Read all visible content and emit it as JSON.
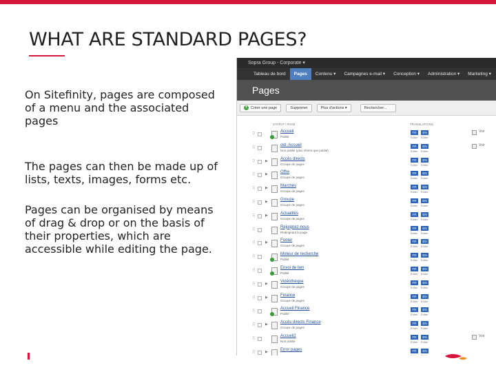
{
  "slide": {
    "title": "WHAT ARE STANDARD PAGES?",
    "paragraph1": "On Sitefinity, pages are composed of a menu and the associated pages",
    "paragraph2": "The pages can then be made up of lists, texts, images, forms etc.",
    "paragraph3": "Pages can be organised by means of drag & drop or on the basis of their properties, which are accessible while editing the page.",
    "accent_color": "#d6153b"
  },
  "screenshot": {
    "site_selector": "Sopra Group - Corporate",
    "nav": [
      {
        "label": "Tableau de bord",
        "active": false
      },
      {
        "label": "Pages",
        "active": true
      },
      {
        "label": "Contenu ▾",
        "active": false
      },
      {
        "label": "Campagnes e-mail ▾",
        "active": false
      },
      {
        "label": "Conception ▾",
        "active": false
      },
      {
        "label": "Administration ▾",
        "active": false
      },
      {
        "label": "Marketing ▾",
        "active": false
      }
    ],
    "header": "Pages",
    "toolbar": {
      "create": "Créer une page",
      "delete": "Supprimer",
      "more_actions": "Plus d'actions ▾",
      "search": "Rechercher..."
    },
    "columns": {
      "status_page": "STATUT / PAGE",
      "translations": "TRANSLATIONS"
    },
    "lang_fr": "FR",
    "lang_en": "EN",
    "edit_label": "Éditer",
    "view_label": "Voir",
    "rows": [
      {
        "name": "Accueil",
        "status": "Publié",
        "icon": "published",
        "caret": false,
        "view": true
      },
      {
        "name": "old_Accueil",
        "status": "Non publié (plus récent que publié)",
        "icon": "page",
        "caret": false,
        "view": true
      },
      {
        "name": "Accès directs",
        "status": "Groupe de pages",
        "icon": "group",
        "caret": true,
        "view": false
      },
      {
        "name": "Offre",
        "status": "Groupe de pages",
        "icon": "group",
        "caret": true,
        "view": false
      },
      {
        "name": "Marchés",
        "status": "Groupe de pages",
        "icon": "group",
        "caret": true,
        "view": false
      },
      {
        "name": "Groupe",
        "status": "Groupe de pages",
        "icon": "group",
        "caret": true,
        "view": false
      },
      {
        "name": "Actualités",
        "status": "Groupe de pages",
        "icon": "group",
        "caret": true,
        "view": false
      },
      {
        "name": "Rejoignez-nous",
        "status": "Redirigeant la page",
        "icon": "page",
        "caret": false,
        "view": false
      },
      {
        "name": "Footer",
        "status": "Groupe de pages",
        "icon": "group",
        "caret": true,
        "view": false
      },
      {
        "name": "Moteur de recherche",
        "status": "Publié",
        "icon": "published",
        "caret": false,
        "view": false
      },
      {
        "name": "Envoi de lien",
        "status": "Publié",
        "icon": "published",
        "caret": false,
        "view": false
      },
      {
        "name": "Vidéothèque",
        "status": "Groupe de pages",
        "icon": "group",
        "caret": true,
        "view": false
      },
      {
        "name": "Finance",
        "status": "Groupe de pages",
        "icon": "group",
        "caret": true,
        "view": false
      },
      {
        "name": "Accueil Finance",
        "status": "Publié",
        "icon": "published",
        "caret": false,
        "view": false
      },
      {
        "name": "Accès directs Finance",
        "status": "Groupe de pages",
        "icon": "group",
        "caret": true,
        "view": false
      },
      {
        "name": "Accueil2",
        "status": "Non publié",
        "icon": "page",
        "caret": false,
        "view": true
      },
      {
        "name": "Error pages",
        "status": "",
        "icon": "group",
        "caret": true,
        "view": false
      }
    ]
  }
}
